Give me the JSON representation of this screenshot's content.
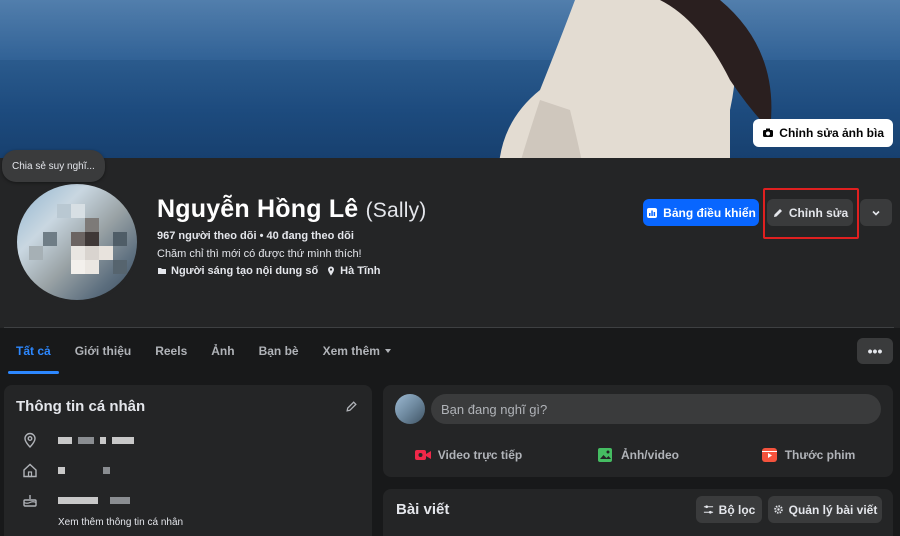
{
  "cover": {
    "edit_cover_label": "Chỉnh sửa ảnh bìa"
  },
  "share_bubble": "Chia sẻ suy nghĩ...",
  "profile": {
    "name": "Nguyễn Hồng Lê",
    "nickname": "(Sally)",
    "followers_line": "967 người theo dõi • 40 đang theo dõi",
    "bio": "Chăm chỉ thì mới có được thứ mình thích!",
    "creator_label": "Người sáng tạo nội dung số",
    "location": "Hà Tĩnh"
  },
  "actions": {
    "dashboard_label": "Bảng điều khiển",
    "edit_label": "Chỉnh sửa"
  },
  "tabs": [
    {
      "label": "Tất cả"
    },
    {
      "label": "Giới thiệu"
    },
    {
      "label": "Reels"
    },
    {
      "label": "Ảnh"
    },
    {
      "label": "Bạn bè"
    },
    {
      "label": "Xem thêm"
    }
  ],
  "tabs_more": "•••",
  "intro": {
    "title": "Thông tin cá nhân",
    "see_more": "Xem thêm thông tin cá nhân"
  },
  "composer": {
    "placeholder": "Bạn đang nghĩ gì?",
    "actions": [
      {
        "label": "Video trực tiếp",
        "color": "#f02849"
      },
      {
        "label": "Ảnh/video",
        "color": "#45bd62"
      },
      {
        "label": "Thước phim",
        "color": "#f5533d"
      }
    ]
  },
  "posts": {
    "title": "Bài viết",
    "filter_label": "Bộ lọc",
    "manage_label": "Quản lý bài viết"
  },
  "colors": {
    "accent": "#0866ff",
    "highlight": "#e02020",
    "background": "#18191a",
    "card": "#242526"
  }
}
